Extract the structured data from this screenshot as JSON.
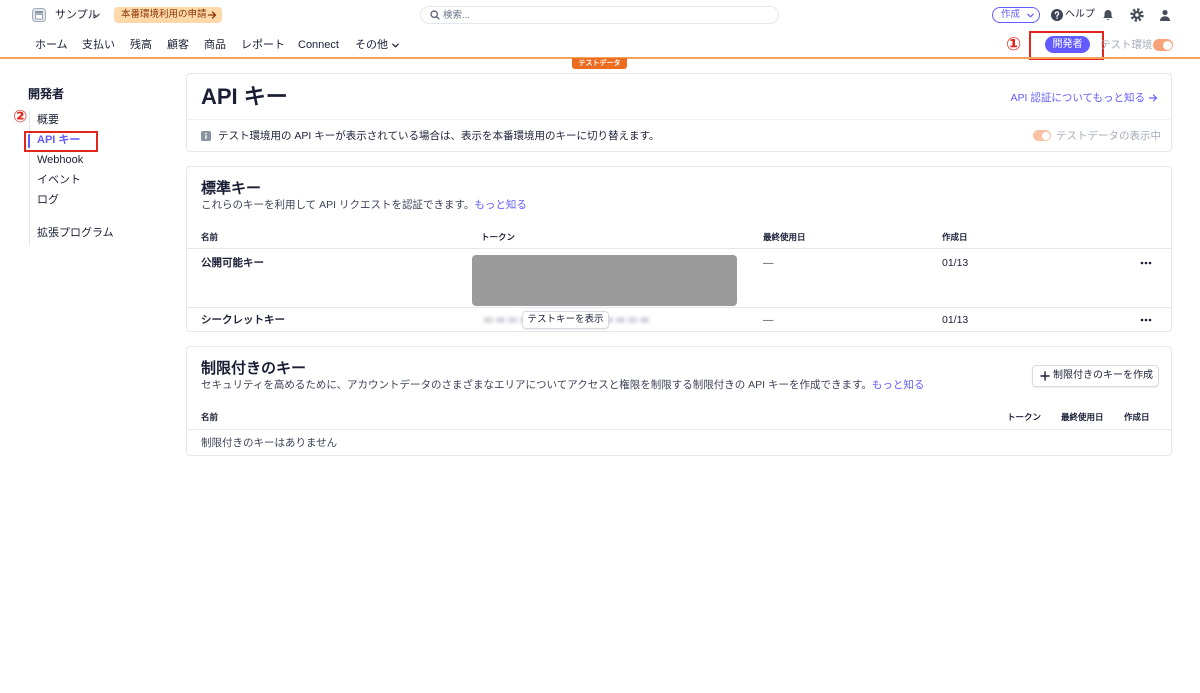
{
  "colors": {
    "accent": "#635bff",
    "test_mode": "#f5a25d",
    "test_data_tab": "#ee6c1f",
    "annotation": "#e0261d",
    "text": "#1a1f36",
    "muted": "#a3acb9"
  },
  "icons": [
    "store-icon",
    "chevron-down-icon",
    "arrow-right-icon",
    "search-icon",
    "help-icon",
    "bell-icon",
    "gear-icon",
    "user-icon",
    "info-icon",
    "more-horizontal-icon",
    "plus-icon"
  ],
  "topbar": {
    "account_name": "サンプル",
    "activation_label": "本番環境利用の申請",
    "search_placeholder": "検索...",
    "create_label": "作成",
    "help_label": "ヘルプ"
  },
  "nav": {
    "items": [
      {
        "label": "ホーム"
      },
      {
        "label": "支払い"
      },
      {
        "label": "残高"
      },
      {
        "label": "顧客"
      },
      {
        "label": "商品"
      },
      {
        "label": "レポート"
      },
      {
        "label": "Connect"
      },
      {
        "label": "その他"
      }
    ],
    "developer_label": "開発者",
    "developer_active": true,
    "test_env_label": "テスト環境",
    "test_env_on": true,
    "test_data_tab": "テストデータ"
  },
  "annotations": {
    "marker_1": "①",
    "marker_2": "②"
  },
  "sidebar": {
    "title": "開発者",
    "items": [
      {
        "label": "概要"
      },
      {
        "label": "API キー",
        "active": true
      },
      {
        "label": "Webhook"
      },
      {
        "label": "イベント"
      },
      {
        "label": "ログ"
      },
      {
        "label": "拡張プログラム"
      }
    ]
  },
  "page": {
    "title": "API キー",
    "docs_link": "API 認証についてもっと知る",
    "notice": "テスト環境用の API キーが表示されている場合は、表示を本番環境用のキーに切り替えます。",
    "viewing_test_data_label": "テストデータの表示中",
    "viewing_test_data": true
  },
  "standard_keys": {
    "title": "標準キー",
    "description": "これらのキーを利用して API リクエストを認証できます。",
    "learn_more": "もっと知る",
    "columns": [
      "名前",
      "トークン",
      "最終使用日",
      "作成日"
    ],
    "rows": [
      {
        "name": "公開可能キー",
        "last_used": "—",
        "created": "01/13"
      },
      {
        "name": "シークレットキー",
        "reveal_label": "テストキーを表示",
        "last_used": "—",
        "created": "01/13"
      }
    ]
  },
  "restricted_keys": {
    "title": "制限付きのキー",
    "description": "セキュリティを高めるために、アカウントデータのさまざまなエリアについてアクセスと権限を制限する制限付きの API キーを作成できます。",
    "learn_more": "もっと知る",
    "create_label": "制限付きのキーを作成",
    "columns": [
      "名前",
      "トークン",
      "最終使用日",
      "作成日"
    ],
    "empty_label": "制限付きのキーはありません"
  }
}
